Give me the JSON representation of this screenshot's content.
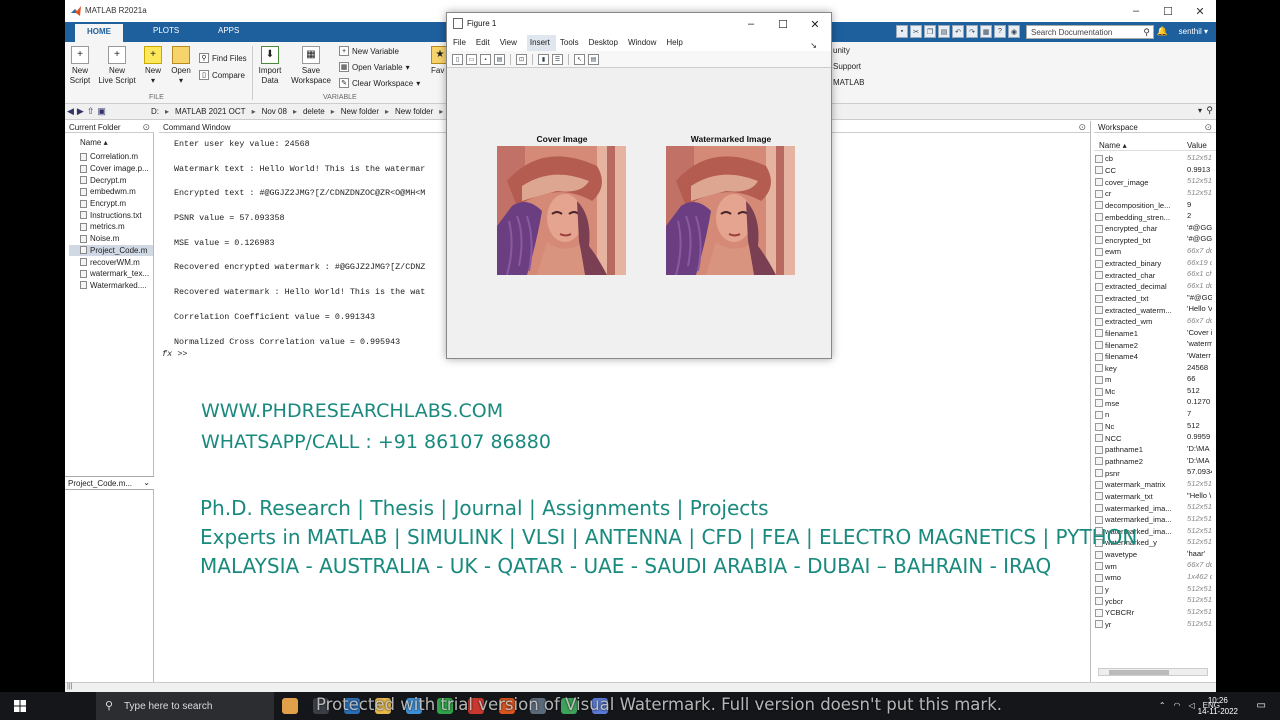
{
  "app": {
    "title": "MATLAB R2021a",
    "user": "senthil",
    "search_placeholder": "Search Documentation"
  },
  "ribbon": {
    "tabs": [
      "HOME",
      "PLOTS",
      "APPS"
    ],
    "new_script": "New\nScript",
    "new_script_l1": "New",
    "new_script_l2": "Script",
    "new_live_l1": "New",
    "new_live_l2": "Live Script",
    "new": "New",
    "open": "Open",
    "find_files": "Find Files",
    "compare": "Compare",
    "import_l1": "Import",
    "import_l2": "Data",
    "save_l1": "Save",
    "save_l2": "Workspace",
    "new_variable": "New Variable",
    "open_variable": "Open Variable",
    "clear_workspace": "Clear Workspace",
    "fav_partial": "Fav",
    "group_file": "FILE",
    "group_variable": "VARIABLE",
    "right_partial_1": "unity",
    "right_partial_2": "Support",
    "right_partial_3": "MATLAB"
  },
  "path": [
    "D:",
    "MATLAB 2021 OCT",
    "Nov 08",
    "delete",
    "New folder",
    "New folder"
  ],
  "current_folder": {
    "title": "Current Folder",
    "col_name": "Name",
    "files": [
      "Correlation.m",
      "Cover image.p...",
      "Decrypt.m",
      "embedwm.m",
      "Encrypt.m",
      "Instructions.txt",
      "metrics.m",
      "Noise.m",
      "Project_Code.m",
      "recoverWM.m",
      "watermark_tex...",
      "Watermarked...."
    ],
    "selected_index": 8,
    "details": "Project_Code.m..."
  },
  "command_window": {
    "title": "Command Window",
    "lines": [
      "Enter user key value: 24568",
      "Watermark text : Hello World! This is the watermar",
      "Encrypted text : #@GGJZ2JMG?[Z/CDNZDNZOC@ZR<O@MH<M",
      "PSNR value = 57.093358",
      "MSE value = 0.126983",
      "Recovered encrypted watermark : #@GGJZ2JMG?[Z/CDNZ",
      "Recovered watermark : Hello World! This is the wat",
      "Correlation Coefficient value = 0.991343",
      "Normalized Cross Correlation value = 0.995943"
    ],
    "prompt_fx": "fx",
    "prompt": ">>"
  },
  "workspace": {
    "title": "Workspace",
    "col_name": "Name",
    "col_value": "Value",
    "vars": [
      {
        "name": "cb",
        "value": "512x512",
        "dim": true
      },
      {
        "name": "CC",
        "value": "0.9913",
        "dim": false
      },
      {
        "name": "cover_image",
        "value": "512x512",
        "dim": true
      },
      {
        "name": "cr",
        "value": "512x512",
        "dim": true
      },
      {
        "name": "decomposition_le...",
        "value": "9",
        "dim": false
      },
      {
        "name": "embedding_stren...",
        "value": "2",
        "dim": false
      },
      {
        "name": "encrypted_char",
        "value": "'#@GG,",
        "dim": false
      },
      {
        "name": "encrypted_txt",
        "value": "'#@GG,",
        "dim": false
      },
      {
        "name": "ewm",
        "value": "66x7 do",
        "dim": true
      },
      {
        "name": "extracted_binary",
        "value": "66x19 c",
        "dim": true
      },
      {
        "name": "extracted_char",
        "value": "66x1 ch",
        "dim": true
      },
      {
        "name": "extracted_decimal",
        "value": "66x1 do",
        "dim": true
      },
      {
        "name": "extracted_txt",
        "value": "\"#@GG",
        "dim": false
      },
      {
        "name": "extracted_waterm...",
        "value": "'Hello V",
        "dim": false
      },
      {
        "name": "extracted_wm",
        "value": "66x7 do",
        "dim": true
      },
      {
        "name": "filename1",
        "value": "'Cover i",
        "dim": false
      },
      {
        "name": "filename2",
        "value": "'waterm",
        "dim": false
      },
      {
        "name": "filename4",
        "value": "'Waterr",
        "dim": false
      },
      {
        "name": "key",
        "value": "24568",
        "dim": false
      },
      {
        "name": "m",
        "value": "66",
        "dim": false
      },
      {
        "name": "Mc",
        "value": "512",
        "dim": false
      },
      {
        "name": "mse",
        "value": "0.1270",
        "dim": false
      },
      {
        "name": "n",
        "value": "7",
        "dim": false
      },
      {
        "name": "Nc",
        "value": "512",
        "dim": false
      },
      {
        "name": "NCC",
        "value": "0.9959",
        "dim": false
      },
      {
        "name": "pathname1",
        "value": "'D:\\MA",
        "dim": false
      },
      {
        "name": "pathname2",
        "value": "'D:\\MA",
        "dim": false
      },
      {
        "name": "psnr",
        "value": "57.0934",
        "dim": false
      },
      {
        "name": "watermark_matrix",
        "value": "512x512",
        "dim": true
      },
      {
        "name": "watermark_txt",
        "value": "\"Hello \\",
        "dim": false
      },
      {
        "name": "watermarked_ima...",
        "value": "512x512",
        "dim": true
      },
      {
        "name": "watermarked_ima...",
        "value": "512x512",
        "dim": true
      },
      {
        "name": "watermarked_ima...",
        "value": "512x512",
        "dim": true
      },
      {
        "name": "watermarked_y",
        "value": "512x512",
        "dim": true
      },
      {
        "name": "wavetype",
        "value": "'haar'",
        "dim": false
      },
      {
        "name": "wm",
        "value": "66x7 do",
        "dim": true
      },
      {
        "name": "wmo",
        "value": "1x462 d",
        "dim": true
      },
      {
        "name": "y",
        "value": "512x512",
        "dim": true
      },
      {
        "name": "ycbcr",
        "value": "512x512",
        "dim": true
      },
      {
        "name": "YCBCRr",
        "value": "512x512",
        "dim": true
      },
      {
        "name": "yr",
        "value": "512x512",
        "dim": true
      }
    ]
  },
  "figure": {
    "title": "Figure 1",
    "menu": [
      "File",
      "Edit",
      "View",
      "Insert",
      "Tools",
      "Desktop",
      "Window",
      "Help"
    ],
    "active_menu": "Insert",
    "axes_titles": [
      "Cover Image",
      "Watermarked Image"
    ]
  },
  "overlay": {
    "line1": "WWW.PHDRESEARCHLABS.COM",
    "line2": "WHATSAPP/CALL : +91 86107 86880",
    "line3": "Ph.D. Research | Thesis | Journal | Assignments | Projects",
    "line4": "Experts in MATLAB | SIMULINK | VLSI | ANTENNA | CFD | FEA | ELECTRO MAGNETICS | PYTHON",
    "line5": "MALAYSIA - AUSTRALIA - UK - QATAR - UAE - SAUDI ARABIA - DUBAI – BAHRAIN - IRAQ",
    "trial": "Protected with trial version of Visual Watermark. Full version doesn't put this mark."
  },
  "taskbar": {
    "search_placeholder": "Type here to search",
    "lang": "ENG",
    "time": "10:26",
    "date": "14-11-2022"
  },
  "colors": {
    "ribbon_blue": "#1e5f9e",
    "ad_teal": "#1a8a7e"
  }
}
